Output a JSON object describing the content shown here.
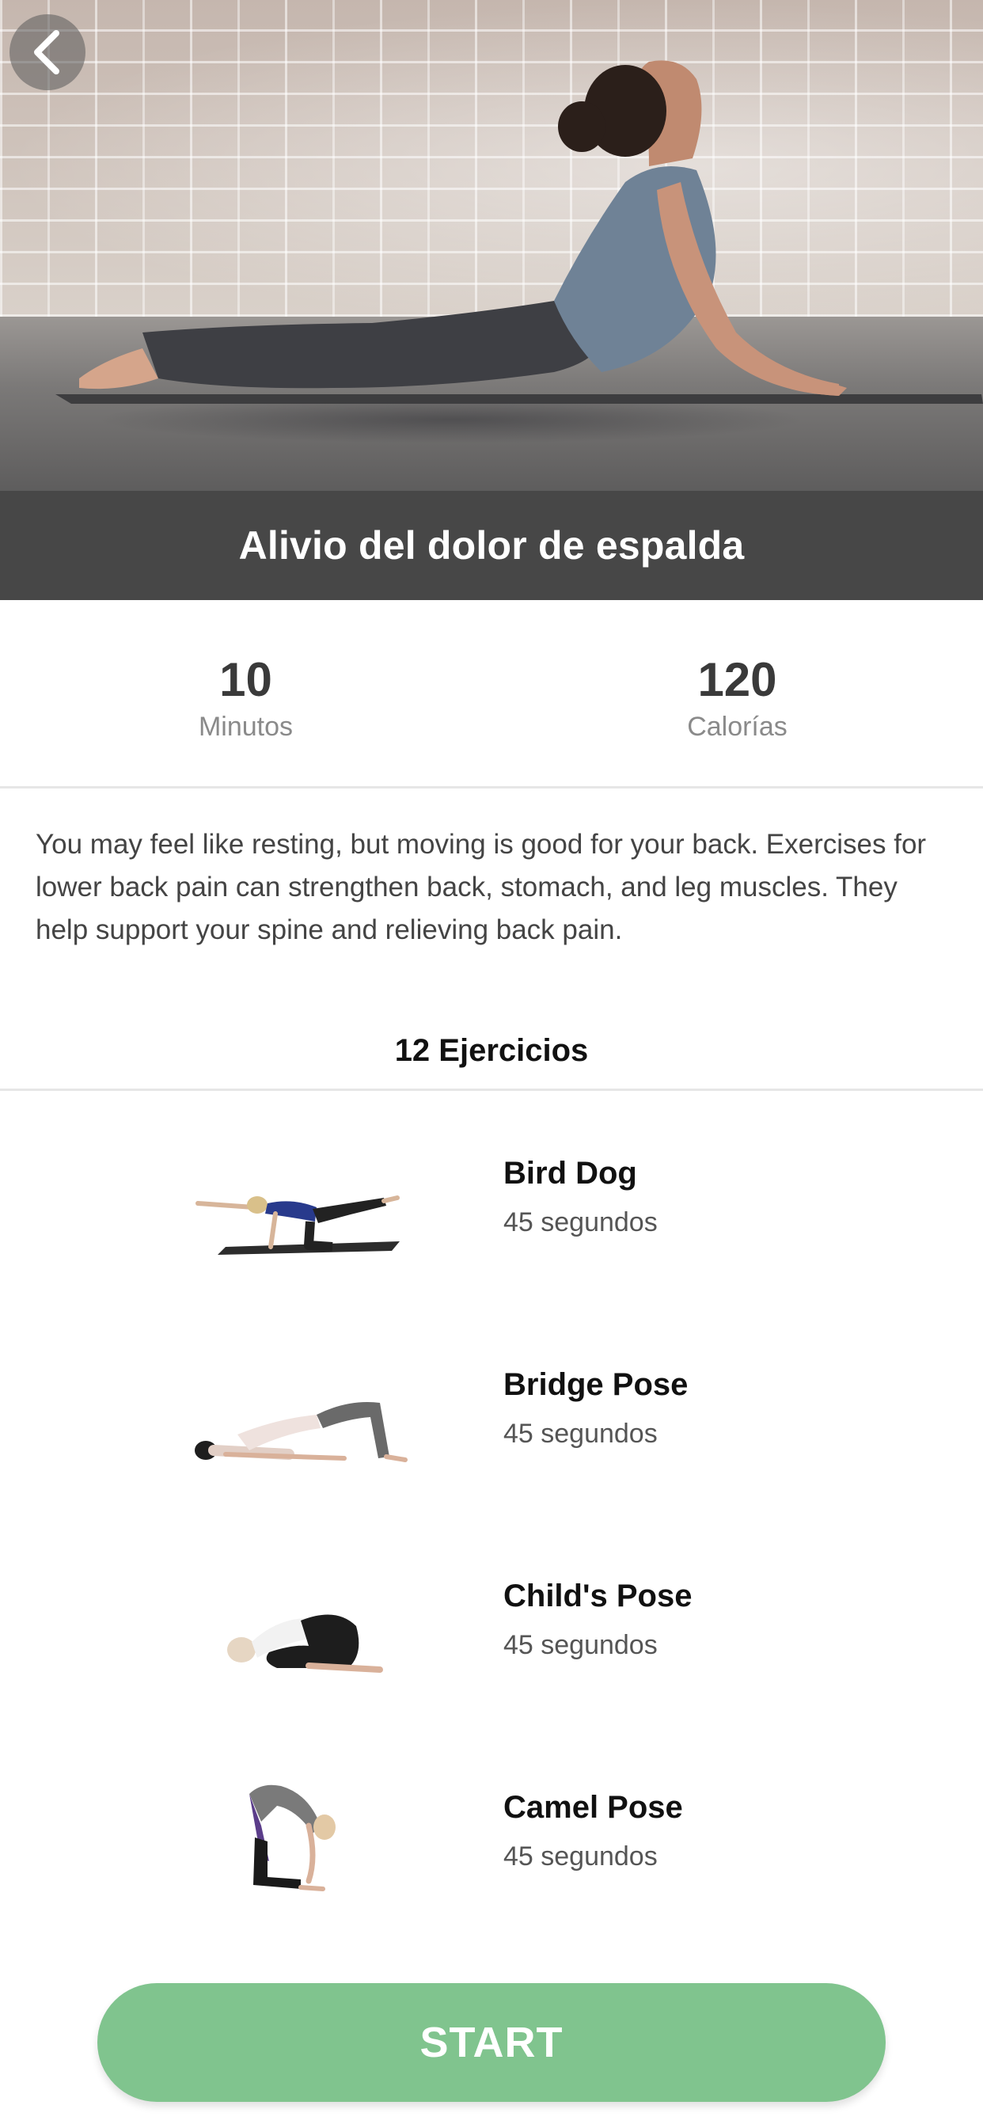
{
  "hero": {
    "image": "woman doing cobra yoga pose on mat in front of brick wall",
    "back_icon": "chevron-left-icon"
  },
  "program": {
    "title": "Alivio del dolor de espalda"
  },
  "stats": [
    {
      "value": "10",
      "label": "Minutos"
    },
    {
      "value": "120",
      "label": "Calorías"
    }
  ],
  "description": "You may feel like resting, but moving is good for your back. Exercises for lower back pain can strengthen back, stomach, and leg muscles. They help support your spine and relieving back pain.",
  "exercise_count_label": "12 Ejercicios",
  "exercises": [
    {
      "name": "Bird Dog",
      "duration": "45 segundos",
      "thumbnail": "bird-dog-pose"
    },
    {
      "name": "Bridge Pose",
      "duration": "45 segundos",
      "thumbnail": "bridge-pose"
    },
    {
      "name": "Child's Pose",
      "duration": "45 segundos",
      "thumbnail": "childs-pose"
    },
    {
      "name": "Camel Pose",
      "duration": "45 segundos",
      "thumbnail": "camel-pose"
    }
  ],
  "start_label": "START",
  "colors": {
    "title_bar": "#474747",
    "start_button": "#80c48e",
    "divider": "#e6e6e6"
  }
}
